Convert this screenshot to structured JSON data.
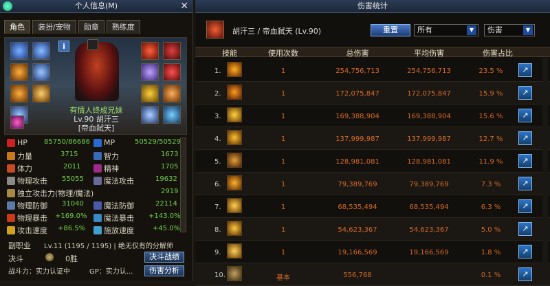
{
  "left_panel": {
    "title": "个人信息(M)",
    "close": "✕",
    "tabs": [
      "角色",
      "装扮/宠物",
      "勋章",
      "熟练度"
    ],
    "info_button": "i",
    "guild": "有情人终成兄妹",
    "level_name": "Lv.90 胡汗三",
    "title_tag": "[帝血弑天]",
    "stats": [
      {
        "l": "HP",
        "lv": "85750/86686",
        "r": "MP",
        "rv": "50529/50529"
      },
      {
        "l": "力量",
        "lv": "3715",
        "r": "智力",
        "rv": "1673"
      },
      {
        "l": "体力",
        "lv": "2011",
        "r": "精神",
        "rv": "1705"
      },
      {
        "l": "物理攻击",
        "lv": "55055",
        "r": "魔法攻击",
        "rv": "19632"
      },
      {
        "l": "独立攻击力(物理/魔法)",
        "lv": "2919",
        "r": "",
        "rv": ""
      },
      {
        "l": "物理防御",
        "lv": "31040",
        "r": "魔法防御",
        "rv": "22114"
      },
      {
        "l": "物理暴击",
        "lv": "+169.0%",
        "r": "魔法暴击",
        "rv": "+143.0%"
      },
      {
        "l": "攻击速度",
        "lv": "+86.5%",
        "r": "施放速度",
        "rv": "+45.0%"
      }
    ],
    "subjob_label": "副职业",
    "subjob_value": "Lv.11 (1195 / 1195) | 绝无仅有的分解师",
    "duel_label": "决斗",
    "duel_value": "0胜",
    "duel_btn": "决斗战绩",
    "power_label": "战斗力：实力认证中",
    "gp_label": "GP：实力认...",
    "analysis_btn": "伤害分析"
  },
  "right_panel": {
    "title": "伤害统计",
    "header_name": "胡汗三 / 帝血弑天 (Lv.90)",
    "reset_button": "重置",
    "filter_select": "所有",
    "type_select": "伤害",
    "columns": [
      "技能",
      "使用次数",
      "总伤害",
      "平均伤害",
      "伤害占比"
    ],
    "rows": [
      {
        "rank": "1.",
        "uses": "1",
        "total": "254,756,713",
        "avg": "254,756,713",
        "pct": "23.5 %"
      },
      {
        "rank": "2.",
        "uses": "1",
        "total": "172,075,847",
        "avg": "172,075,847",
        "pct": "15.9 %"
      },
      {
        "rank": "3.",
        "uses": "1",
        "total": "169,388,904",
        "avg": "169,388,904",
        "pct": "15.6 %"
      },
      {
        "rank": "4.",
        "uses": "1",
        "total": "137,999,987",
        "avg": "137,999,987",
        "pct": "12.7 %"
      },
      {
        "rank": "5.",
        "uses": "1",
        "total": "128,981,081",
        "avg": "128,981,081",
        "pct": "11.9 %"
      },
      {
        "rank": "6.",
        "uses": "1",
        "total": "79,389,769",
        "avg": "79,389,769",
        "pct": "7.3 %"
      },
      {
        "rank": "7.",
        "uses": "1",
        "total": "68,535,494",
        "avg": "68,535,494",
        "pct": "6.3 %"
      },
      {
        "rank": "8.",
        "uses": "1",
        "total": "54,623,367",
        "avg": "54,623,367",
        "pct": "5.0 %"
      },
      {
        "rank": "9.",
        "uses": "1",
        "total": "19,166,569",
        "avg": "19,166,569",
        "pct": "1.8 %"
      },
      {
        "rank": "10.",
        "uses": "基本",
        "total": "556,768",
        "avg": "",
        "pct": "0.1 %"
      }
    ],
    "export_icon": "↗"
  }
}
